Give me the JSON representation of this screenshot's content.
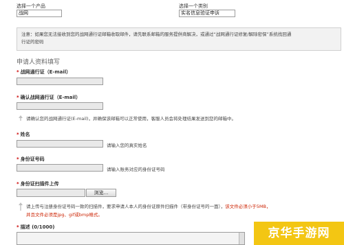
{
  "product": {
    "label": "选择一个产品",
    "value": "战网"
  },
  "category": {
    "label": "选择一个类别",
    "value": "实名信息验证申诉"
  },
  "notice": {
    "line1": "注意：如果您无法接收到您的战网通行证邮箱收取邮件，请先联系邮箱的服务提供商解决，或通过“战网通行证修复/解除密保”系统找回通",
    "line2": "行证的密码"
  },
  "section_title": "申请人资料填写",
  "fields": {
    "email": {
      "label": "战网通行证（E-mail）"
    },
    "confirm_email": {
      "label": "确认战网通行证（E-mail）",
      "hint": "请确认您的战网通行证(E-mail)，并确保该邮箱可以正常使用，客服人员会将处理结果发送到您的邮箱中。"
    },
    "name": {
      "label": "姓名",
      "hint": "请输入您的真实姓名"
    },
    "id_number": {
      "label": "身份证号码",
      "hint": "请输入账务对应的身份证号码"
    },
    "id_scan": {
      "label": "身份证扫描件上传",
      "browse": "浏览...",
      "hint_line1_a": "请上传与注册身份证号码一致的扫描件，要求申请人本人的身份证原件扫描件（带身份证号的一面），",
      "hint_line1_b": "该文件必须小于5MB，",
      "hint_line2": "并且文件必须是jpg、gif或bmp格式。"
    },
    "description": {
      "label": "描述 (0/1000)"
    }
  },
  "watermark": "京华手游网"
}
